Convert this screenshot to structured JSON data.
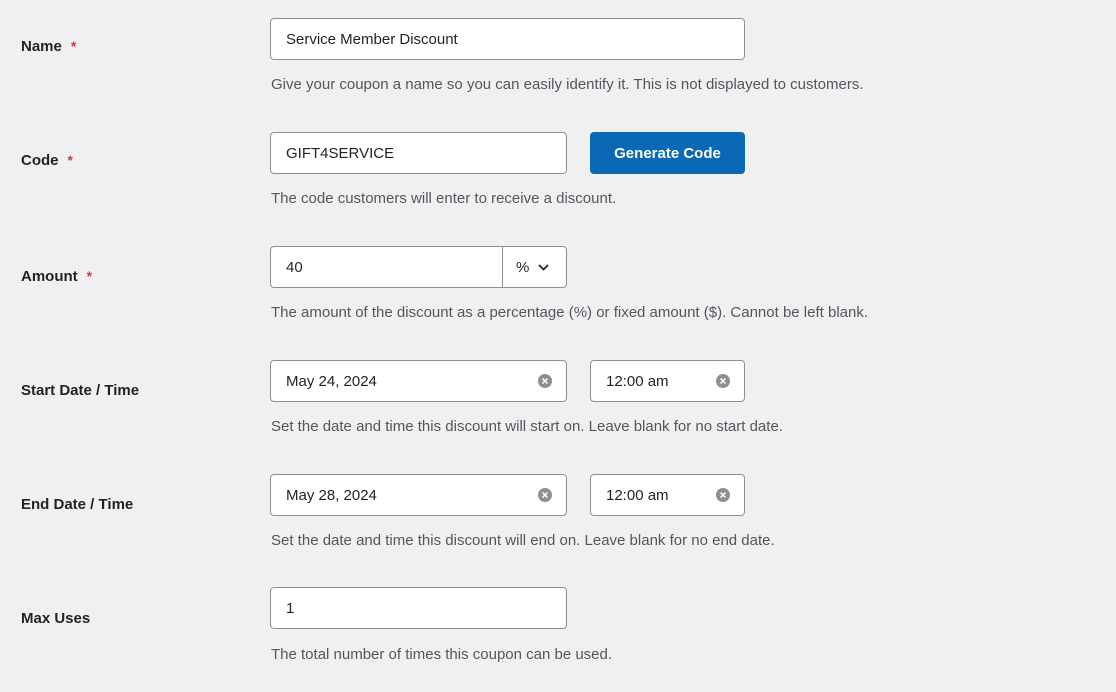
{
  "required_marker": "*",
  "fields": {
    "name": {
      "label": "Name",
      "value": "Service Member Discount",
      "help": "Give your coupon a name so you can easily identify it. This is not displayed to customers."
    },
    "code": {
      "label": "Code",
      "value": "GIFT4SERVICE",
      "button_label": "Generate Code",
      "help": "The code customers will enter to receive a discount."
    },
    "amount": {
      "label": "Amount",
      "value": "40",
      "type_selected": "%",
      "help": "The amount of the discount as a percentage (%) or fixed amount ($). Cannot be left blank."
    },
    "start": {
      "label": "Start Date / Time",
      "date": "May 24, 2024",
      "time": "12:00 am",
      "help": "Set the date and time this discount will start on. Leave blank for no start date."
    },
    "end": {
      "label": "End Date / Time",
      "date": "May 28, 2024",
      "time": "12:00 am",
      "help": "Set the date and time this discount will end on. Leave blank for no end date."
    },
    "max_uses": {
      "label": "Max Uses",
      "value": "1",
      "help": "The total number of times this coupon can be used."
    }
  },
  "colors": {
    "primary_button": "#0a68b4",
    "required": "#d63638",
    "background": "#f0f0f1"
  }
}
